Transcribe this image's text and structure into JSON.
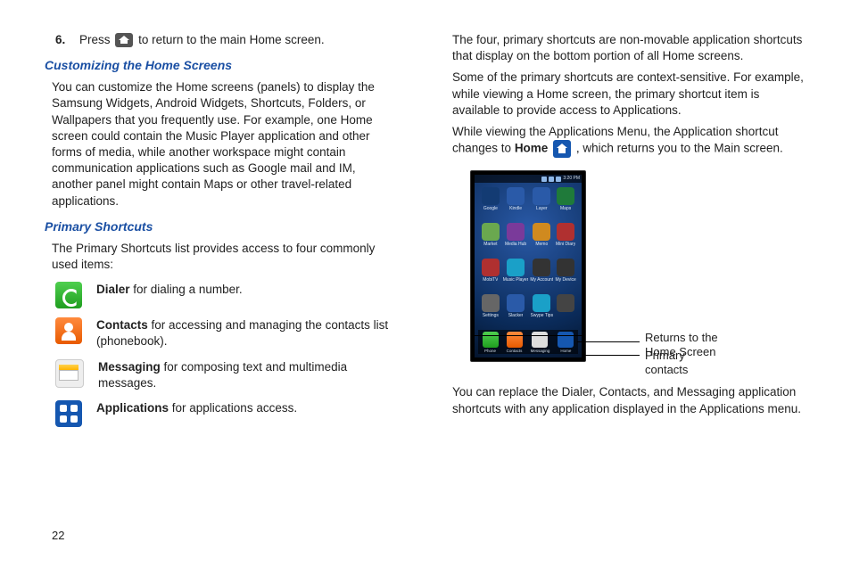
{
  "page_number": "22",
  "left": {
    "step_num": "6.",
    "step_text_a": "Press ",
    "step_text_b": " to return to the main Home screen.",
    "heading1": "Customizing the Home Screens",
    "para1": "You can customize the Home screens (panels) to display the Samsung Widgets, Android Widgets, Shortcuts, Folders, or Wallpapers that you frequently use. For example, one Home screen could contain the Music Player application and other forms of media, while another workspace might contain communication applications such as Google mail and IM, another panel might contain Maps or other travel-related applications.",
    "heading2": "Primary Shortcuts",
    "para2": "The Primary Shortcuts list provides access to four commonly used items:",
    "shortcuts": [
      {
        "name": "Dialer",
        "desc": " for dialing a number."
      },
      {
        "name": "Contacts",
        "desc": "  for accessing and managing the contacts list (phonebook)."
      },
      {
        "name": "Messaging",
        "desc": " for composing text and multimedia messages."
      },
      {
        "name": "Applications",
        "desc": "  for applications access."
      }
    ]
  },
  "right": {
    "para1": "The four, primary shortcuts are non-movable application shortcuts that display on the bottom portion of all Home screens.",
    "para2": "Some of the primary shortcuts are context-sensitive. For example, while viewing a Home screen, the primary shortcut item is available to provide access to Applications.",
    "para3a": "While viewing the Applications Menu, the Application shortcut changes to ",
    "para3_bold": "Home",
    "para3b": " , which returns you to the Main screen.",
    "para4": "You can replace the Dialer, Contacts, and Messaging application shortcuts with any application displayed in the Applications menu.",
    "callout1": "Returns to the Home Screen",
    "callout2": "Primary contacts",
    "status_time": "3:20 PM",
    "apps": [
      {
        "l": "Google",
        "c": "#133b73"
      },
      {
        "l": "Kindle",
        "c": "#2a5aa8"
      },
      {
        "l": "Layer",
        "c": "#2a5aa8"
      },
      {
        "l": "Maps",
        "c": "#1f7a3a"
      },
      {
        "l": "Market",
        "c": "#6aa84f"
      },
      {
        "l": "Media Hub",
        "c": "#7a3a9a"
      },
      {
        "l": "Memo",
        "c": "#d08a1f"
      },
      {
        "l": "Mini Diary",
        "c": "#b03030"
      },
      {
        "l": "MobiTV",
        "c": "#b03030"
      },
      {
        "l": "Music Player",
        "c": "#1aa0c8"
      },
      {
        "l": "My Account",
        "c": "#333"
      },
      {
        "l": "My Device",
        "c": "#333"
      },
      {
        "l": "Settings",
        "c": "#666"
      },
      {
        "l": "Slacker",
        "c": "#2a5aa8"
      },
      {
        "l": "Swype Tips",
        "c": "#1aa0c8"
      },
      {
        "l": "",
        "c": "#444"
      }
    ],
    "dock": [
      {
        "l": "Phone",
        "c": "linear-gradient(#4fcf4f,#1f9e1f)"
      },
      {
        "l": "Contacts",
        "c": "linear-gradient(#ff8a3d,#e85a00)"
      },
      {
        "l": "Messaging",
        "c": "#ddd"
      },
      {
        "l": "Home",
        "c": "#1557b0"
      }
    ]
  }
}
